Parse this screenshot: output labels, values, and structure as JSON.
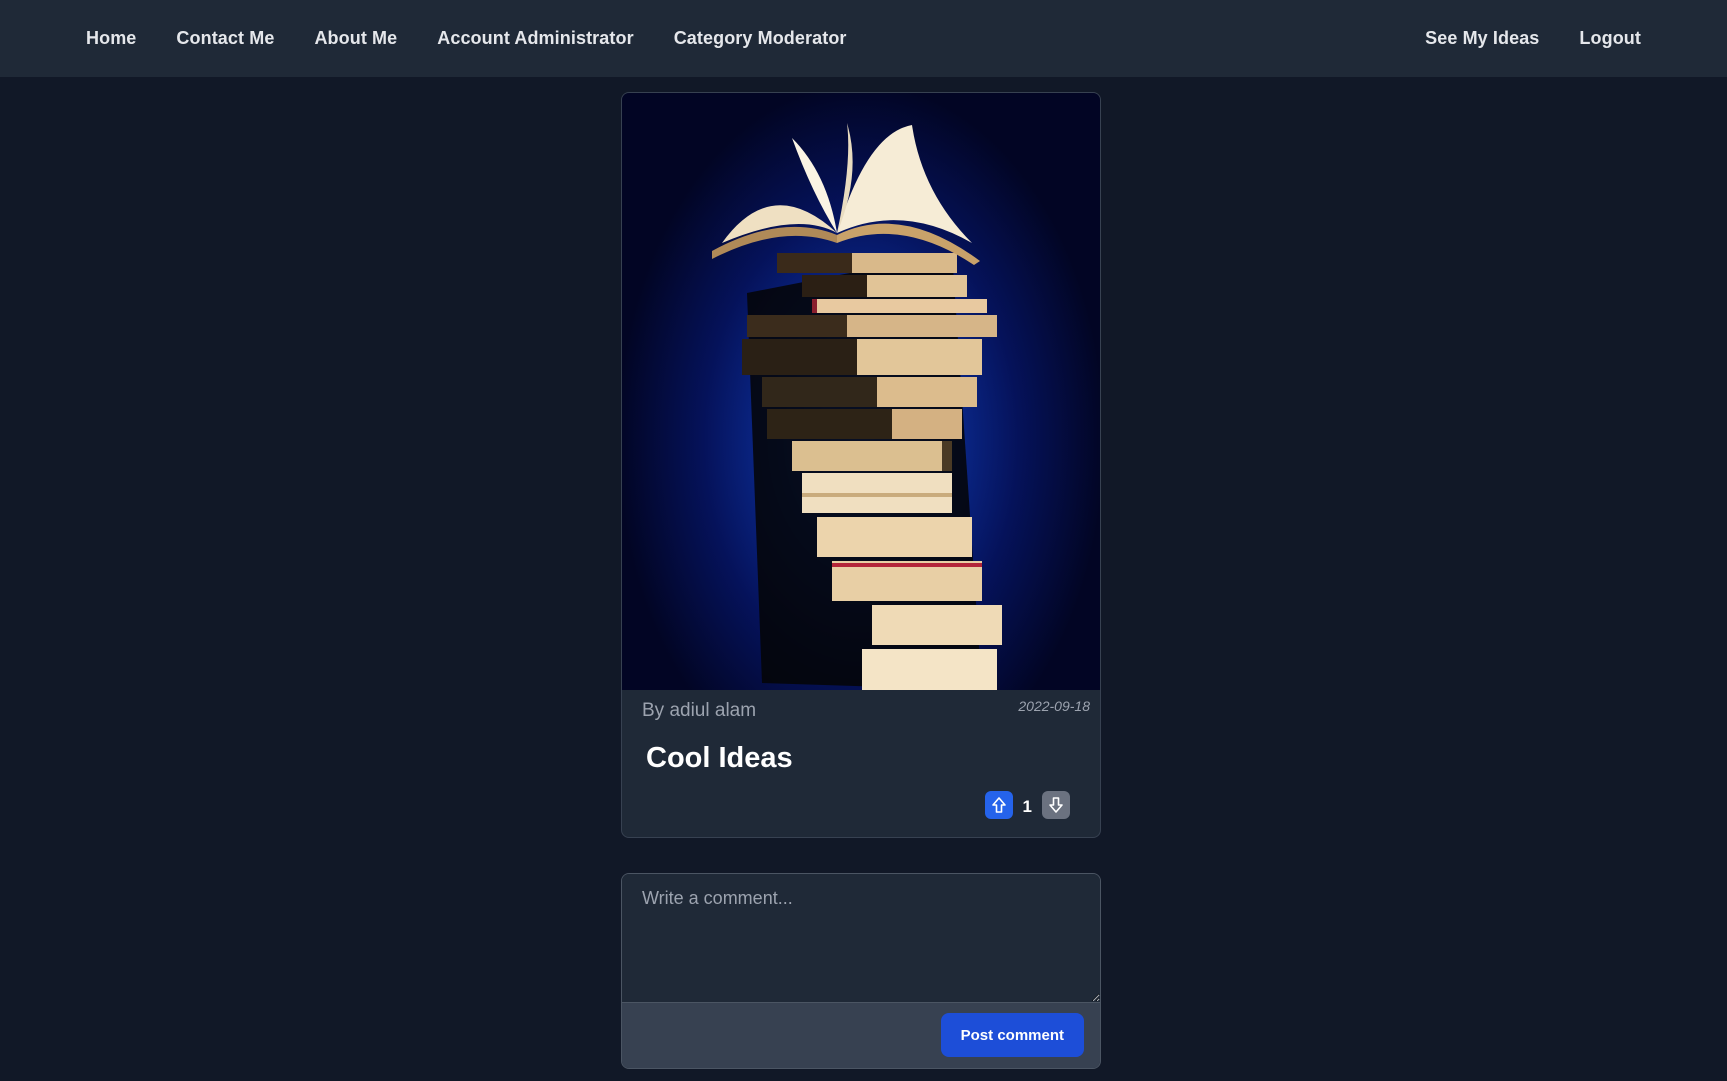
{
  "nav": {
    "left": [
      {
        "label": "Home"
      },
      {
        "label": "Contact Me"
      },
      {
        "label": "About Me"
      },
      {
        "label": "Account Administrator"
      },
      {
        "label": "Category Moderator"
      }
    ],
    "right": [
      {
        "label": "See My Ideas"
      },
      {
        "label": "Logout"
      }
    ]
  },
  "idea": {
    "image_alt": "stack of books",
    "author": "By adiul alam",
    "date": "2022-09-18",
    "title": "Cool Ideas",
    "votes": "1",
    "upvote_icon": "arrow-up-icon",
    "downvote_icon": "arrow-down-icon"
  },
  "comment": {
    "placeholder": "Write a comment...",
    "value": "",
    "submit_label": "Post comment"
  },
  "colors": {
    "page_bg": "#111827",
    "nav_bg": "#1f2937",
    "card_bg": "#1f2937",
    "upvote_bg": "#2563eb",
    "downvote_bg": "#6b7280",
    "button_bg": "#1d4ed8"
  }
}
